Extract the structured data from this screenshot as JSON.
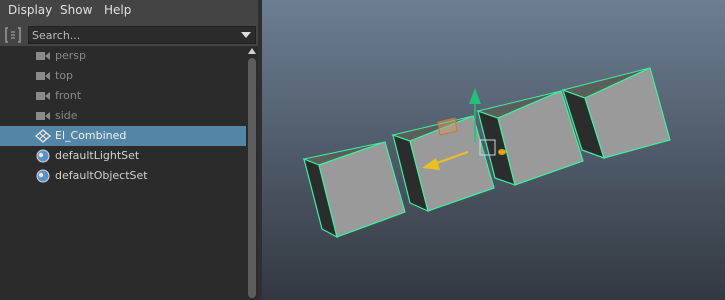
{
  "menu": {
    "display": "Display",
    "show": "Show",
    "help": "Help"
  },
  "search": {
    "placeholder": "Search..."
  },
  "outliner": {
    "items": [
      {
        "label": "persp",
        "icon": "camera-icon",
        "dim": true,
        "selected": false
      },
      {
        "label": "top",
        "icon": "camera-icon",
        "dim": true,
        "selected": false
      },
      {
        "label": "front",
        "icon": "camera-icon",
        "dim": true,
        "selected": false
      },
      {
        "label": "side",
        "icon": "camera-icon",
        "dim": true,
        "selected": false
      },
      {
        "label": "El_Combined",
        "icon": "mesh-transform-icon",
        "dim": false,
        "selected": true
      },
      {
        "label": "defaultLightSet",
        "icon": "set-icon",
        "dim": false,
        "selected": false
      },
      {
        "label": "defaultObjectSet",
        "icon": "set-icon",
        "dim": false,
        "selected": false
      }
    ]
  },
  "colors": {
    "selection": "#5285a6",
    "mesh_highlight": "#3ff0a0",
    "manipulator_y": "#22c07a",
    "manipulator_x": "#e8c020",
    "manipulator_z": "#e0a018"
  }
}
